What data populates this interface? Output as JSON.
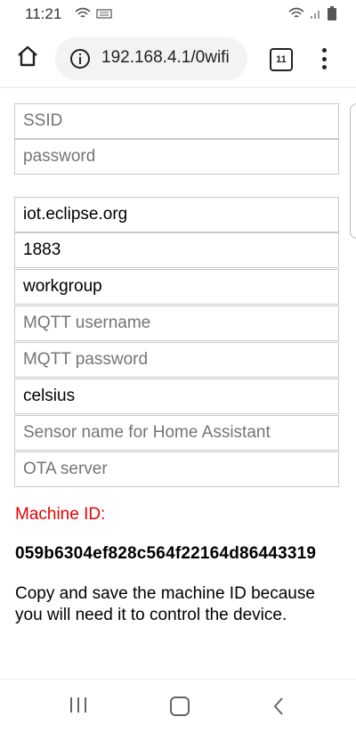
{
  "status_bar": {
    "time": "11:21"
  },
  "browser": {
    "url": "192.168.4.1/0wifi",
    "tab_count": "11"
  },
  "wifi_form": {
    "ssid_placeholder": "SSID",
    "password_placeholder": "password"
  },
  "mqtt_form": {
    "server_value": "iot.eclipse.org",
    "port_value": "1883",
    "group_value": "workgroup",
    "username_placeholder": "MQTT username",
    "password_placeholder": "MQTT password",
    "unit_value": "celsius",
    "sensor_name_placeholder": "Sensor name for Home Assistant",
    "ota_placeholder": "OTA server"
  },
  "machine": {
    "label": "Machine ID:",
    "id": "059b6304ef828c564f22164d86443319",
    "note": "Copy and save the machine ID because you will need it to control the device."
  },
  "colors": {
    "machine_label": "#e60000",
    "field_border": "#c9c9c9",
    "placeholder": "#757575",
    "url_bar_bg": "#f1f3f4"
  },
  "icons": {
    "status_left": [
      "wifi-icon",
      "keyboard-icon"
    ],
    "status_right": [
      "wifi-icon",
      "signal-icon",
      "battery-icon"
    ],
    "toolbar": [
      "home-icon",
      "info-icon",
      "tabs-icon",
      "more-vert-icon"
    ],
    "navbar": [
      "recent-apps-icon",
      "home-icon",
      "back-icon"
    ]
  }
}
